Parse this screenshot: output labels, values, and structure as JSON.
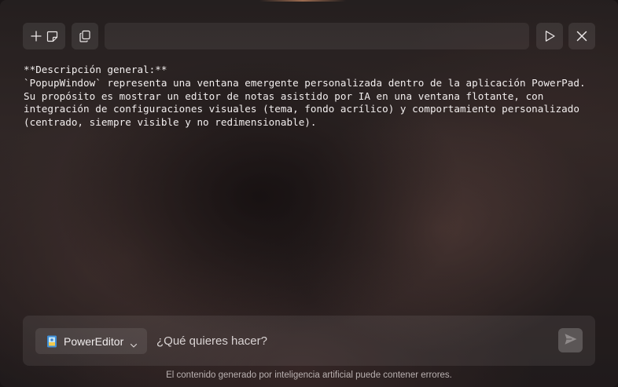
{
  "toolbar": {
    "new_note_icon": "add-note-icon",
    "copy_icon": "copy-icon",
    "title_value": "",
    "run_icon": "play-icon",
    "close_icon": "close-icon"
  },
  "document": {
    "lines": [
      "**Descripción general:**",
      "`PopupWindow` representa una ventana emergente personalizada dentro de la aplicación PowerPad.",
      "Su propósito es mostrar un editor de notas asistido por IA en una ventana flotante, con",
      "integración de configuraciones visuales (tema, fondo acrílico) y comportamiento personalizado",
      "(centrado, siempre visible y no redimensionable)."
    ]
  },
  "prompt": {
    "model_label": "PowerEditor",
    "model_icon": "notebook-icon",
    "placeholder": "¿Qué quieres hacer?",
    "value": "",
    "send_icon": "send-icon"
  },
  "footer": {
    "disclaimer": "El contenido generado por inteligencia artificial puede contener errores."
  },
  "colors": {
    "text": "#f2eeee",
    "muted": "#b9b1b1",
    "button_bg": "rgba(255,255,255,0.085)"
  }
}
